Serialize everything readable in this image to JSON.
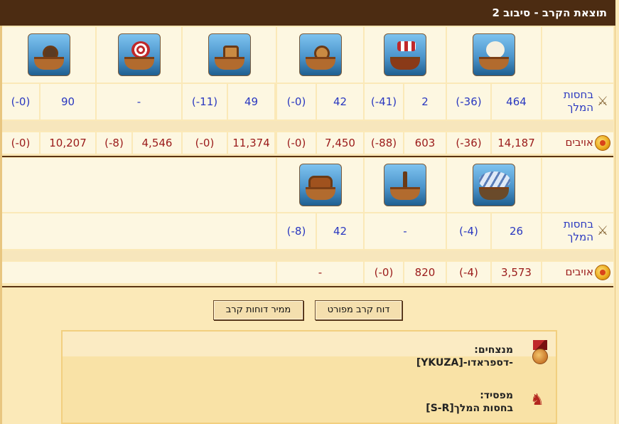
{
  "title": "תוצאת הקרב - סיבוב 2",
  "labels": {
    "king_guard": "בחסות המלך",
    "enemies": "אויבים"
  },
  "icons": {
    "king_guard": "crossed-swords-icon",
    "enemies": "enemy-coin-icon",
    "winner": "medal-icon",
    "loser": "troops-icon"
  },
  "round1": {
    "units": [
      "fire-ship-unit",
      "ram-ship-unit",
      "paddle-wheel-ram-unit",
      "ballista-ship-unit",
      "catapult-ship-unit",
      "mortar-ship-unit"
    ],
    "king": [
      {
        "count": "464",
        "loss": "(-36)"
      },
      {
        "count": "2",
        "loss": "(-41)"
      },
      {
        "count": "42",
        "loss": "(-0)"
      },
      {
        "count": "49",
        "loss": "(-11)"
      },
      {
        "count": "-",
        "loss": ""
      },
      {
        "count": "90",
        "loss": "(-0)"
      }
    ],
    "enemies": [
      {
        "count": "14,187",
        "loss": "(-36)"
      },
      {
        "count": "603",
        "loss": "(-88)"
      },
      {
        "count": "7,450",
        "loss": "(-0)"
      },
      {
        "count": "11,374",
        "loss": "(-0)"
      },
      {
        "count": "4,546",
        "loss": "(-8)"
      },
      {
        "count": "10,207",
        "loss": "(-0)"
      }
    ]
  },
  "round2": {
    "units": [
      "balloon-carrier-unit",
      "diving-boat-unit",
      "rocket-ship-unit"
    ],
    "king": [
      {
        "count": "26",
        "loss": "(-4)"
      },
      {
        "count": "-",
        "loss": ""
      },
      {
        "count": "42",
        "loss": "(-8)"
      }
    ],
    "enemies": [
      {
        "count": "3,573",
        "loss": "(-4)"
      },
      {
        "count": "820",
        "loss": "(-0)"
      },
      {
        "count": "-",
        "loss": ""
      }
    ]
  },
  "buttons": {
    "detailed_report": "דוח קרב מפורט",
    "report_converter": "ממיר דוחות קרב"
  },
  "result": {
    "winners_label": "מנצחים:",
    "winners_value": "-דספראדו-[YKUZA]",
    "loser_label": "מפסיד:",
    "loser_value": "בחסות המלך[S-R]"
  }
}
